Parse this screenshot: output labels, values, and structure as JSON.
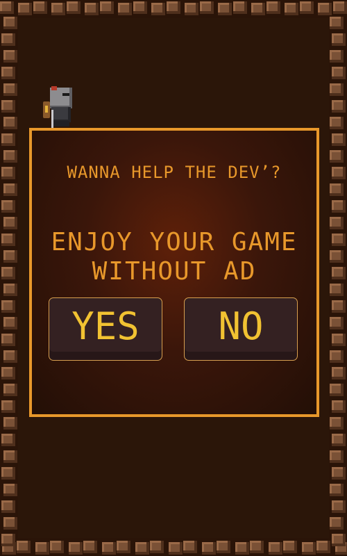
{
  "dialog": {
    "question": "WANNA HELP THE DEV’?",
    "offer_line1": "ENJOY YOUR GAME",
    "offer_line2": "WITHOUT AD",
    "yes_label": "YES",
    "no_label": "NO"
  },
  "colors": {
    "accent": "#e8982b",
    "button_text": "#f1c232",
    "stone": "#7a5136",
    "background": "#2a1408"
  },
  "sprites": {
    "player": "knight-icon"
  }
}
